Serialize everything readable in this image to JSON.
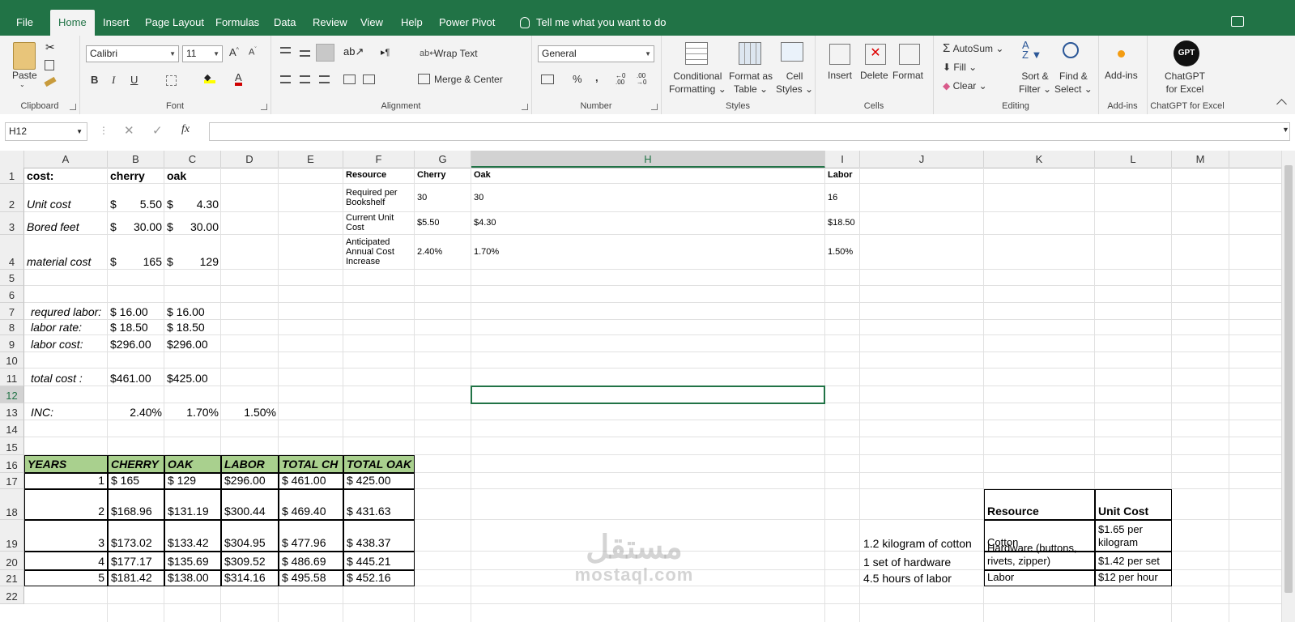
{
  "tabs": [
    "File",
    "Home",
    "Insert",
    "Page Layout",
    "Formulas",
    "Data",
    "Review",
    "View",
    "Help",
    "Power Pivot"
  ],
  "active_tab": "Home",
  "tell_me": "Tell me what you want to do",
  "ribbon": {
    "clipboard": {
      "paste": "Paste",
      "label": "Clipboard"
    },
    "font": {
      "name": "Calibri",
      "size": "11",
      "bold": "B",
      "italic": "I",
      "underline": "U",
      "label": "Font"
    },
    "alignment": {
      "wrap": "Wrap Text",
      "merge": "Merge & Center",
      "label": "Alignment"
    },
    "number": {
      "format": "General",
      "percent": "%",
      "comma": ",",
      "label": "Number"
    },
    "styles": {
      "cond": "Conditional",
      "cond2": "Formatting",
      "fmt": "Format as",
      "fmt2": "Table",
      "cell": "Cell",
      "cell2": "Styles",
      "label": "Styles"
    },
    "cells": {
      "insert": "Insert",
      "delete": "Delete",
      "format": "Format",
      "label": "Cells"
    },
    "editing": {
      "autosum": "AutoSum",
      "fill": "Fill",
      "clear": "Clear",
      "sort": "Sort &",
      "sort2": "Filter",
      "find": "Find &",
      "find2": "Select",
      "label": "Editing"
    },
    "addins": {
      "btn": "Add-ins",
      "label": "Add-ins"
    },
    "chatgpt": {
      "logo": "GPT",
      "btn": "ChatGPT",
      "btn2": "for Excel",
      "label": "ChatGPT for Excel"
    }
  },
  "namebox": "H12",
  "fx": "fx",
  "columns": [
    "A",
    "B",
    "C",
    "D",
    "E",
    "F",
    "G",
    "H",
    "I",
    "J",
    "K",
    "L",
    "M"
  ],
  "rows": [
    "1",
    "2",
    "3",
    "4",
    "5",
    "6",
    "7",
    "8",
    "9",
    "10",
    "11",
    "12",
    "13",
    "14",
    "15",
    "16",
    "17",
    "18",
    "19",
    "20",
    "21",
    "22"
  ],
  "cells": {
    "A1": "cost:",
    "B1": "cherry",
    "C1": "oak",
    "A2": "Unit cost",
    "B2s": "$",
    "B2": "5.50",
    "C2s": "$",
    "C2": "4.30",
    "A3": "Bored feet",
    "B3s": "$",
    "B3": "30.00",
    "C3s": "$",
    "C3": "30.00",
    "A4": "material cost",
    "B4s": "$",
    "B4": "165",
    "C4s": "$",
    "C4": "129",
    "A7": "requred labor:",
    "B7": "$ 16.00",
    "C7": "$ 16.00",
    "A8": "labor rate:",
    "B8": "$ 18.50",
    "C8": "$ 18.50",
    "A9": "labor cost:",
    "B9": "$296.00",
    "C9": "$296.00",
    "A11": "total cost :",
    "B11": "$461.00",
    "C11": "$425.00",
    "A13": "INC:",
    "B13": "2.40%",
    "C13": "1.70%",
    "D13": "1.50%",
    "F1": "Resource",
    "G1": "Cherry",
    "H1": "Oak",
    "I1": "Labor",
    "F2": "Required per Bookshelf",
    "G2": "30",
    "H2": "30",
    "I2": "16",
    "F3": "Current Unit Cost",
    "G3": "$5.50",
    "H3": "$4.30",
    "I3": "$18.50",
    "F4": "Anticipated Annual Cost Increase",
    "G4": "2.40%",
    "H4": "1.70%",
    "I4": "1.50%",
    "J19": "1.2 kilogram of cotton",
    "J20": "1 set of hardware",
    "J21": "4.5 hours of labor"
  },
  "years_table": {
    "headers": [
      "YEARS",
      "CHERRY",
      "OAK",
      "LABOR",
      "TOTAL CH",
      "TOTAL OAK"
    ],
    "rows": [
      [
        "1",
        "$ 165",
        "$ 129",
        "$296.00",
        "$ 461.00",
        "$ 425.00"
      ],
      [
        "2",
        "$168.96",
        "$131.19",
        "$300.44",
        "$ 469.40",
        "$ 431.63"
      ],
      [
        "3",
        "$173.02",
        "$133.42",
        "$304.95",
        "$ 477.96",
        "$ 438.37"
      ],
      [
        "4",
        "$177.17",
        "$135.69",
        "$309.52",
        "$ 486.69",
        "$ 445.21"
      ],
      [
        "5",
        "$181.42",
        "$138.00",
        "$314.16",
        "$ 495.58",
        "$ 452.16"
      ]
    ]
  },
  "resource_table": {
    "headers": [
      "Resource",
      "Unit Cost"
    ],
    "rows": [
      [
        "Cotton",
        "$1.65 per kilogram"
      ],
      [
        "Hardware (buttons, rivets, zipper)",
        "$1.42 per set"
      ],
      [
        "Labor",
        "$12 per hour"
      ]
    ]
  },
  "watermark": {
    "arabic": "مستقل",
    "latin": "mostaql.com"
  },
  "colors": {
    "excel_green": "#217346",
    "header_fill": "#a9d08e"
  }
}
